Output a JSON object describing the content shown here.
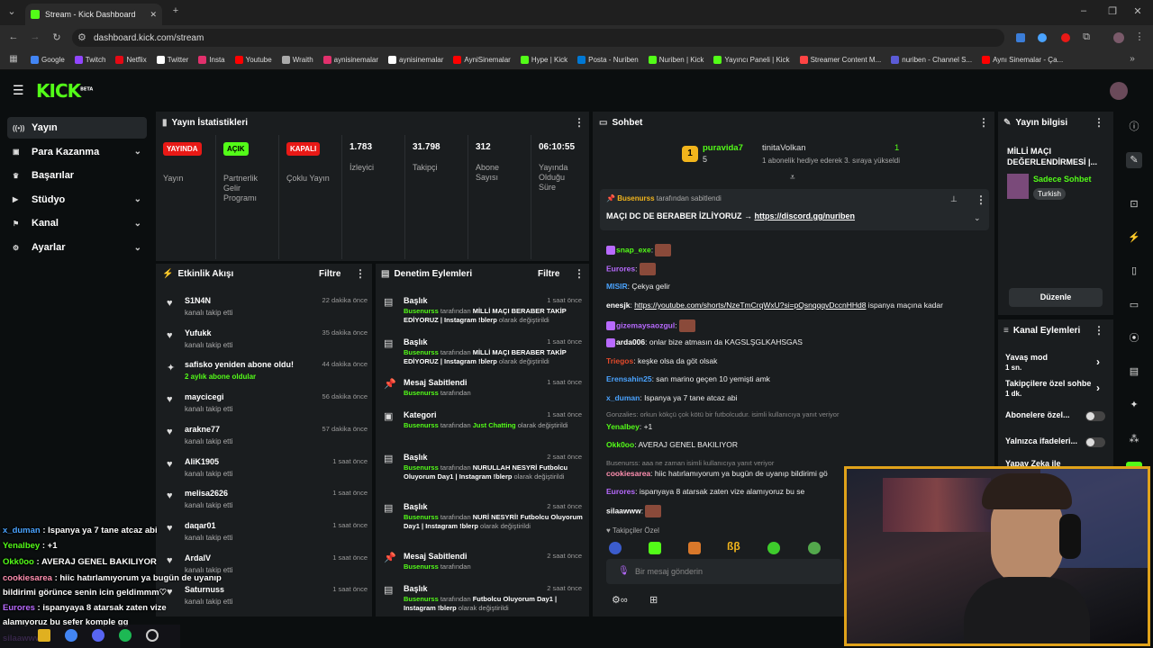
{
  "browser": {
    "tab_title": "Stream - Kick Dashboard",
    "url": "dashboard.kick.com/stream",
    "bookmarks": [
      {
        "label": "Google",
        "color": "#4285f4"
      },
      {
        "label": "Twitch",
        "color": "#9146ff"
      },
      {
        "label": "Netflix",
        "color": "#e50914"
      },
      {
        "label": "Twitter",
        "color": "#ffffff"
      },
      {
        "label": "Insta",
        "color": "#e1306c"
      },
      {
        "label": "Youtube",
        "color": "#ff0000"
      },
      {
        "label": "Wraith",
        "color": "#aaaaaa"
      },
      {
        "label": "aynisinemalar",
        "color": "#e1306c"
      },
      {
        "label": "aynisinemalar",
        "color": "#ffffff"
      },
      {
        "label": "AyniSinemalar",
        "color": "#ff0000"
      },
      {
        "label": "Hype | Kick",
        "color": "#53fc18"
      },
      {
        "label": "Posta - Nuriben",
        "color": "#0078d4"
      },
      {
        "label": "Nuriben | Kick",
        "color": "#53fc18"
      },
      {
        "label": "Yayıncı Paneli | Kick",
        "color": "#53fc18"
      },
      {
        "label": "Streamer Content M...",
        "color": "#ff4444"
      },
      {
        "label": "nuriben - Channel S...",
        "color": "#5b5bd6"
      },
      {
        "label": "Aynı Sinemalar - Ça...",
        "color": "#ff0000"
      }
    ]
  },
  "logo": {
    "text": "KICK",
    "sup": "BETA"
  },
  "sidebar": [
    {
      "label": "Yayın",
      "icon": "broadcast-icon",
      "chev": false,
      "active": true
    },
    {
      "label": "Para Kazanma",
      "icon": "money-icon",
      "chev": true
    },
    {
      "label": "Başarılar",
      "icon": "trophy-icon",
      "chev": false
    },
    {
      "label": "Stüdyo",
      "icon": "video-icon",
      "chev": true
    },
    {
      "label": "Kanal",
      "icon": "flag-icon",
      "chev": true
    },
    {
      "label": "Ayarlar",
      "icon": "gear-icon",
      "chev": true
    }
  ],
  "stats": {
    "title": "Yayın İstatistikleri",
    "cols": [
      {
        "badge": "YAYINDA",
        "badge_color": "#e91916",
        "label": "Yayın"
      },
      {
        "badge": "AÇIK",
        "badge_color": "#53fc18",
        "label": "Partnerlik Gelir Programı"
      },
      {
        "badge": "KAPALI",
        "badge_color": "#e91916",
        "label": "Çoklu Yayın"
      },
      {
        "value": "1.783",
        "label": "İzleyici"
      },
      {
        "value": "31.798",
        "label": "Takipçi"
      },
      {
        "value": "312",
        "label": "Abone Sayısı"
      },
      {
        "value": "06:10:55",
        "label": "Yayında Olduğu Süre"
      }
    ]
  },
  "activity": {
    "title": "Etkinlik Akışı",
    "filter": "Filtre",
    "items": [
      {
        "name": "S1N4N",
        "sub": "kanalı takip etti",
        "time": "22 dakika önce",
        "icon": "heart-icon"
      },
      {
        "name": "Yufukk",
        "sub": "kanalı takip etti",
        "time": "35 dakika önce",
        "icon": "heart-icon"
      },
      {
        "name": "safisko yeniden abone oldu!",
        "sub": "2 aylık abone oldular",
        "time": "44 dakika önce",
        "icon": "star-icon"
      },
      {
        "name": "maycicegi",
        "sub": "kanalı takip etti",
        "time": "56 dakika önce",
        "icon": "heart-icon"
      },
      {
        "name": "arakne77",
        "sub": "kanalı takip etti",
        "time": "57 dakika önce",
        "icon": "heart-icon"
      },
      {
        "name": "AliK1905",
        "sub": "kanalı takip etti",
        "time": "1 saat önce",
        "icon": "heart-icon"
      },
      {
        "name": "melisa2626",
        "sub": "kanalı takip etti",
        "time": "1 saat önce",
        "icon": "heart-icon"
      },
      {
        "name": "daqar01",
        "sub": "kanalı takip etti",
        "time": "1 saat önce",
        "icon": "heart-icon"
      },
      {
        "name": "ArdalV",
        "sub": "kanalı takip etti",
        "time": "1 saat önce",
        "icon": "heart-icon"
      },
      {
        "name": "Saturnuss",
        "sub": "kanalı takip etti",
        "time": "1 saat önce",
        "icon": "heart-icon"
      }
    ]
  },
  "moderation": {
    "title": "Denetim Eylemleri",
    "filter": "Filtre",
    "items": [
      {
        "title": "Başlık",
        "time": "1 saat önce",
        "by": "Busenurss",
        "mid": " tarafından ",
        "val": "MİLLİ MAÇI BERABER TAKİP EDİYORUZ | Instagram !blerp",
        "tail": " olarak değiştirildi",
        "icon": "title-icon"
      },
      {
        "title": "Başlık",
        "time": "1 saat önce",
        "by": "Busenurss",
        "mid": " tarafından ",
        "val": "MİLLİ MAÇI BERABER TAKİP EDİYORUZ | Instagram !blerp",
        "tail": " olarak değiştirildi",
        "icon": "title-icon"
      },
      {
        "title": "Mesaj Sabitlendi",
        "time": "1 saat önce",
        "by": "Busenurss",
        "mid": " tarafından",
        "val": "",
        "tail": "",
        "icon": "pin-icon"
      },
      {
        "title": "Kategori",
        "time": "1 saat önce",
        "by": "Busenurss",
        "mid": " tarafından ",
        "val": "Just Chatting",
        "tail": " olarak değiştirildi",
        "icon": "category-icon"
      },
      {
        "title": "Başlık",
        "time": "2 saat önce",
        "by": "Busenurss",
        "mid": " tarafından ",
        "val": "NURULLAH NESYRİ Futbolcu Oluyorum Day1 | Instagram !blerp",
        "tail": " olarak değiştirildi",
        "icon": "title-icon"
      },
      {
        "title": "Başlık",
        "time": "2 saat önce",
        "by": "Busenurss",
        "mid": " tarafından ",
        "val": "NURİ NESYRİ! Futbolcu Oluyorum Day1 | Instagram !blerp",
        "tail": " olarak değiştirildi",
        "icon": "title-icon"
      },
      {
        "title": "Mesaj Sabitlendi",
        "time": "2 saat önce",
        "by": "Busenurss",
        "mid": " tarafından",
        "val": "",
        "tail": "",
        "icon": "pin-icon"
      },
      {
        "title": "Başlık",
        "time": "2 saat önce",
        "by": "Busenurss",
        "mid": " tarafından ",
        "val": "Futbolcu Oluyorum Day1 | Instagram !blerp",
        "tail": " olarak değiştirildi",
        "icon": "title-icon"
      }
    ]
  },
  "chat": {
    "title": "Sohbet",
    "gift": {
      "top": "puravida7",
      "top_count": "5",
      "user": "tinitaVolkan",
      "count": "1",
      "msg": "1 abonelik hediye ederek 3. sıraya yükseldi"
    },
    "pinned": {
      "by": "Busenurss",
      "suffix": " tarafından sabitlendi",
      "text": "MAÇI DC DE BERABER İZLİYORUZ → ",
      "link": "https://discord.gg/nuriben"
    },
    "messages": [
      {
        "user": "snap_exe",
        "color": "#53fc18",
        "text": "",
        "emote": true
      },
      {
        "user": "Eurores",
        "color": "#b86aff",
        "text": "",
        "emote": true
      },
      {
        "user": "MISIR",
        "color": "#4aa3ff",
        "text": "Çekya gelir"
      },
      {
        "user": "enesjk",
        "color": "#ffffff",
        "text": "",
        "link": "https://youtube.com/shorts/NzeTmCrqWxU?si=pQsnqqqvDccnHHd8",
        "after": " ispanya maçına kadar"
      },
      {
        "user": "gizemaysaozgul",
        "color": "#b86aff",
        "text": "",
        "emote": true
      },
      {
        "user": "arda006",
        "color": "#ffffff",
        "text": "onlar bize atmasın da KAGSLŞGLKAHSGAS"
      },
      {
        "user": "Triegos",
        "color": "#e24a2b",
        "text": "keşke olsa da göt olsak"
      },
      {
        "user": "Erensahin25",
        "color": "#4aa3ff",
        "text": "san marino geçen 10 yemişti amk"
      },
      {
        "user": "x_duman",
        "color": "#4aa3ff",
        "text": "Ispanya ya 7 tane atcaz abi"
      },
      {
        "reply": "Gonzalies: orkun kökçü çok kötü bir futbolcudur. isimli kullanıcıya yanıt veriyor"
      },
      {
        "user": "Yenalbey",
        "color": "#53fc18",
        "text": "+1"
      },
      {
        "user": "Okk0oo",
        "color": "#53fc18",
        "text": "AVERAJ GENEL BAKILIYOR"
      },
      {
        "reply": "Busenurss: aaa ne zaman isimli kullanıcıya yanıt veriyor"
      },
      {
        "user": "cookiesarea",
        "color": "#ff8fb0",
        "text": "hiic hatırlamıyorum ya bugün de uyanıp bildirimi gö"
      },
      {
        "user": "Eurores",
        "color": "#b86aff",
        "text": "ispanyaya 8 atarsak zaten vize alamıyoruz bu se"
      },
      {
        "user": "silaawww",
        "color": "#ffffff",
        "text": "",
        "emote": true
      }
    ],
    "follower_only": "Takipçiler Özel",
    "placeholder": "Bir mesaj gönderin"
  },
  "stream_info": {
    "title": "Yayın bilgisi",
    "name": "MİLLİ MAÇI DEĞERLENDİRMESİ |...",
    "category": "Sadece Sohbet",
    "lang": "Turkish",
    "edit": "Düzenle"
  },
  "channel_actions": {
    "title": "Kanal Eylemleri",
    "items": [
      {
        "label": "Yavaş mod",
        "sub": "1 sn.",
        "type": "arrow"
      },
      {
        "label": "Takipçilere özel sohbe",
        "sub": "1 dk.",
        "type": "arrow"
      },
      {
        "label": "Abonelere özel...",
        "type": "toggle"
      },
      {
        "label": "Yalnızca ifadeleri...",
        "type": "toggle"
      },
      {
        "label": "Yapay Zeka ile",
        "type": "none"
      }
    ]
  },
  "overlay_chat": [
    {
      "user": "x_duman",
      "color": "#4aa3ff",
      "text": " : Ispanya ya 7 tane atcaz abi"
    },
    {
      "user": "Yenalbey",
      "color": "#53fc18",
      "text": " : +1"
    },
    {
      "user": "Okk0oo",
      "color": "#53fc18",
      "text": " : AVERAJ GENEL BAKILIYOR"
    },
    {
      "user": "cookiesarea",
      "color": "#ff8fb0",
      "text": " : hiic hatırlamıyorum ya bugün de uyanıp"
    },
    {
      "user": "",
      "color": "#ffffff",
      "text": "bildirimi görünce senin icin geldimmm♡"
    },
    {
      "user": "Eurores",
      "color": "#b86aff",
      "text": " : ispanyaya 8 atarsak zaten vize"
    },
    {
      "user": "",
      "color": "#ffffff",
      "text": "alamıyoruz bu sefer komple gg"
    },
    {
      "user": "silaawww",
      "color": "#b86aff",
      "text": ""
    }
  ]
}
